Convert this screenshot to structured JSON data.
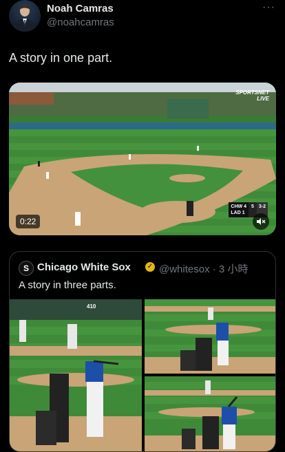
{
  "tweet": {
    "author_name": "Noah Camras",
    "author_handle": "@noahcamras",
    "more_icon": "more-dots-icon",
    "text": "A story in one part."
  },
  "video": {
    "time": "0:22",
    "network": [
      "SPORTSNET",
      "LIVE"
    ],
    "scorebug": {
      "team1": "CHW",
      "score1": "4",
      "team2": "LAD",
      "score2": "1",
      "inning": "5",
      "count": "3-2"
    },
    "mute_icon": "mute-icon"
  },
  "quoted": {
    "author_name": "Chicago White Sox",
    "verified_icon": "verified-gold-icon",
    "handle_time": "@whitesox · 3 小時",
    "text": "A story in three parts.",
    "scoreboard_text": "410"
  },
  "colors": {
    "background": "#000000",
    "text_primary": "#e7e9ea",
    "text_secondary": "#71767b",
    "border": "#2f3336",
    "verified": "#e2b719"
  }
}
